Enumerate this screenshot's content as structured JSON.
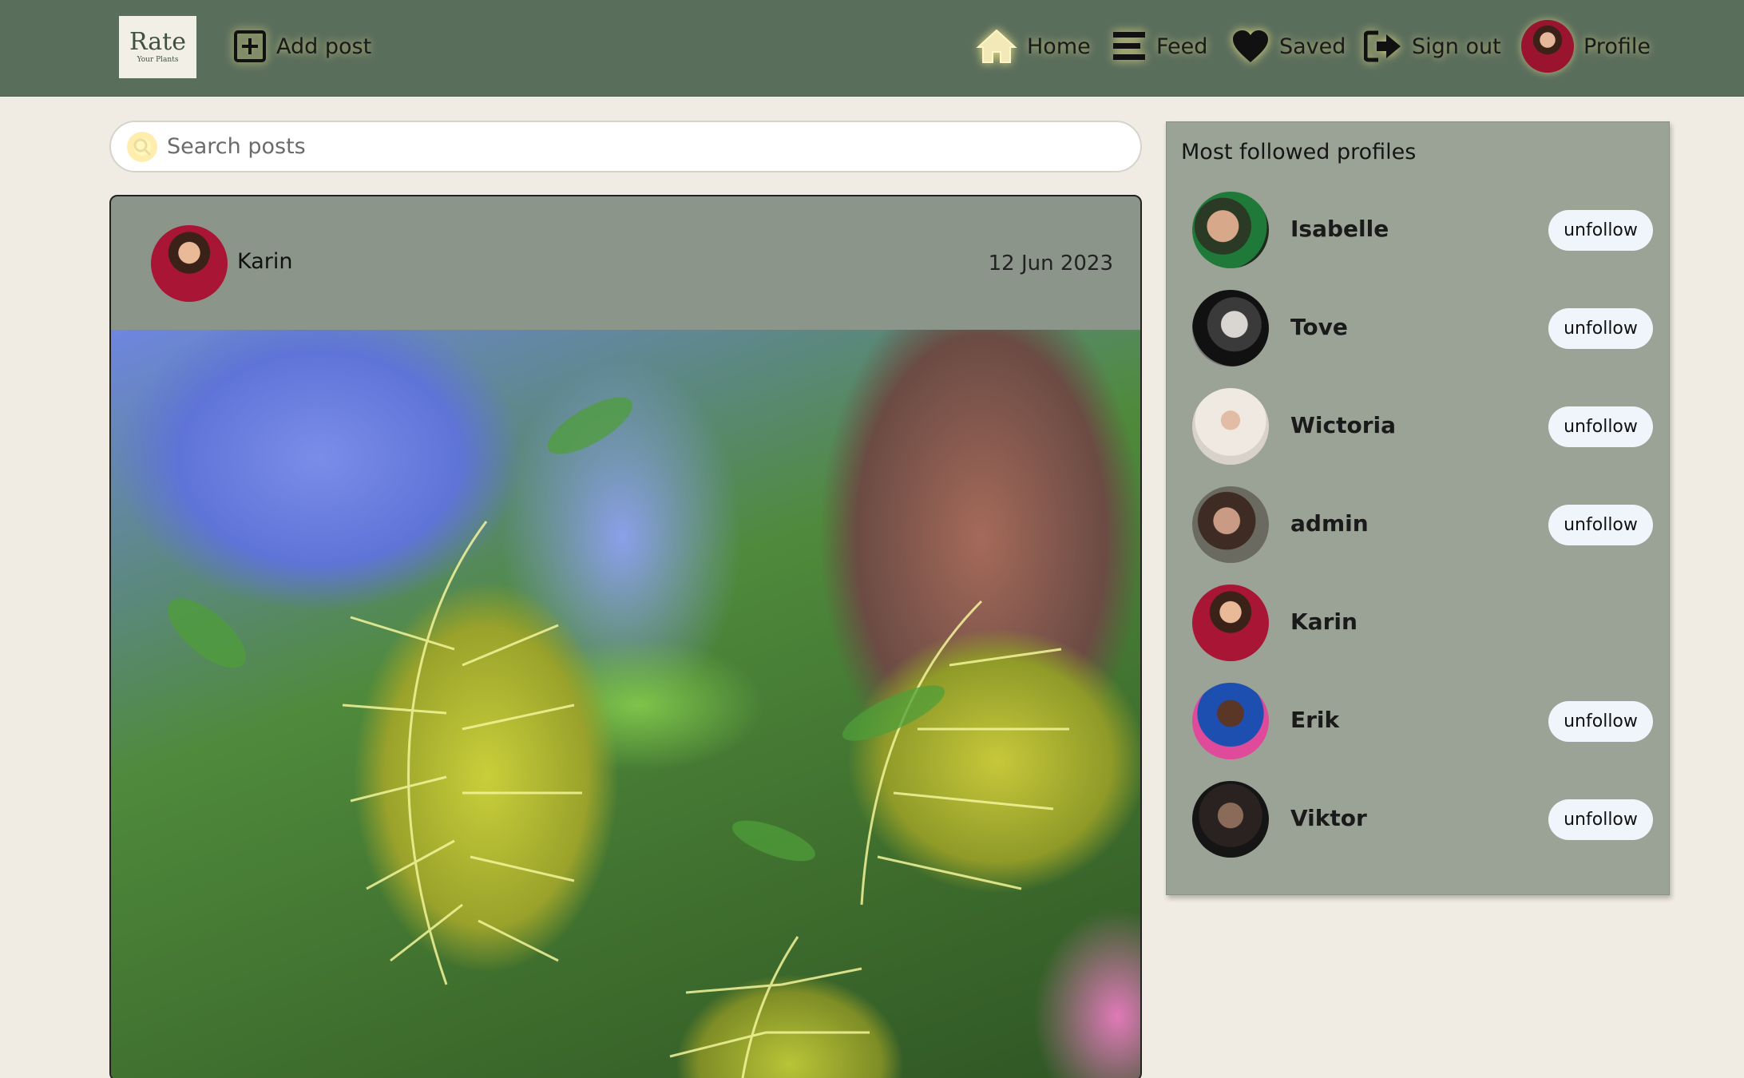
{
  "logo": {
    "line1": "Rate",
    "line2": "Your Plants"
  },
  "nav": {
    "add_post": "Add post",
    "home": "Home",
    "feed": "Feed",
    "saved": "Saved",
    "sign_out": "Sign out",
    "profile": "Profile"
  },
  "search": {
    "placeholder": "Search posts",
    "value": ""
  },
  "post": {
    "author": "Karin",
    "date": "12 Jun 2023"
  },
  "sidebar": {
    "title": "Most followed profiles",
    "profiles": [
      {
        "name": "Isabelle",
        "button": "unfollow"
      },
      {
        "name": "Tove",
        "button": "unfollow"
      },
      {
        "name": "Wictoria",
        "button": "unfollow"
      },
      {
        "name": "admin",
        "button": "unfollow"
      },
      {
        "name": "Karin",
        "button": ""
      },
      {
        "name": "Erik",
        "button": "unfollow"
      },
      {
        "name": "Viktor",
        "button": "unfollow"
      }
    ]
  },
  "colors": {
    "navbar": "#5a6e5c",
    "page_background": "#f0ece3",
    "post_card": "#8c958a",
    "sidebar": "#9ba396",
    "button": "#f0f5fb",
    "icon_glow": "#fff0a0"
  },
  "icons": [
    "add-square-icon",
    "home-icon",
    "feed-menu-icon",
    "heart-icon",
    "sign-out-icon",
    "search-icon"
  ]
}
